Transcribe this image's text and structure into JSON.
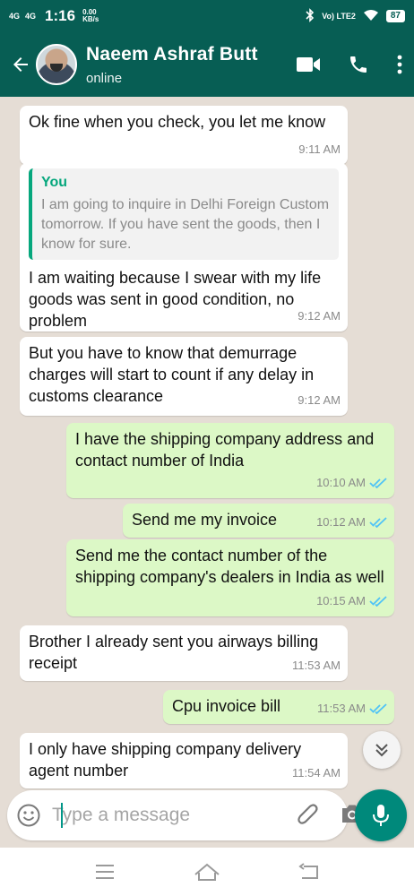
{
  "status_bar": {
    "net1": "4G",
    "net2": "4G",
    "time": "1:16",
    "speed_value": "0.00",
    "speed_unit": "KB/s",
    "volte": "Vo) LTE2",
    "battery": "87"
  },
  "header": {
    "contact_name": "Naeem Ashraf Butt",
    "contact_status": "online",
    "icons": [
      "back-arrow-icon",
      "video-call-icon",
      "phone-icon",
      "more-vertical-icon"
    ]
  },
  "messages": [
    {
      "dir": "in",
      "text": "Ok fine when you check, you let me know",
      "time": "9:11 AM"
    },
    {
      "dir": "in",
      "quote_author": "You",
      "quote_text": "I am going to inquire in Delhi Foreign Custom tomorrow. If you have sent the goods, then I know for sure.",
      "text": "I am waiting because I swear with my life goods was sent in good condition, no problem",
      "time": "9:12 AM"
    },
    {
      "dir": "in",
      "text": "But you have to know that demurrage charges will start to count if any delay in customs clearance",
      "time": "9:12 AM"
    },
    {
      "dir": "out",
      "text": "I have the shipping company address and contact number of India",
      "time": "10:10 AM"
    },
    {
      "dir": "out",
      "text": "Send me my invoice",
      "time": "10:12 AM"
    },
    {
      "dir": "out",
      "text": "Send me the contact number of the shipping company's dealers in India as well",
      "time": "10:15 AM"
    },
    {
      "dir": "in",
      "text": "Brother I already sent you airways billing receipt",
      "time": "11:53 AM"
    },
    {
      "dir": "out",
      "text": "Cpu invoice bill",
      "time": "11:53 AM"
    },
    {
      "dir": "in",
      "text": "I only have shipping company delivery agent number",
      "time": "11:54 AM"
    }
  ],
  "composer": {
    "placeholder": "Type a message",
    "icons": [
      "emoji-icon",
      "attach-icon",
      "camera-icon",
      "mic-icon"
    ]
  },
  "colors": {
    "header": "#075e54",
    "chat_bg": "#e5ddd5",
    "outgoing": "#dcf8c6",
    "incoming": "#ffffff",
    "accent": "#00897b",
    "read_ticks": "#4fc3f7"
  }
}
